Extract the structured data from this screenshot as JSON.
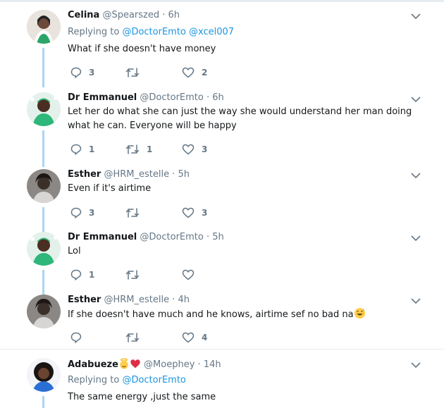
{
  "tweets": [
    {
      "name": "Celina",
      "handle": "@Spearszed",
      "time": "6h",
      "replying_prefix": "Replying to",
      "replying_to": [
        "@DoctorEmto",
        "@xcel007"
      ],
      "text": "What if she doesn't have money",
      "replies": "3",
      "retweets": "",
      "likes": "2"
    },
    {
      "name": "Dr Emmanuel",
      "handle": "@DoctorEmto",
      "time": "6h",
      "text": "Let her do what she can just the way she would understand her man doing what he can. Everyone will be happy",
      "replies": "1",
      "retweets": "1",
      "likes": "3"
    },
    {
      "name": "Esther",
      "handle": "@HRM_estelle",
      "time": "5h",
      "text": "Even if it's airtime",
      "replies": "3",
      "retweets": "",
      "likes": "3"
    },
    {
      "name": "Dr Emmanuel",
      "handle": "@DoctorEmto",
      "time": "5h",
      "text": "Lol",
      "replies": "1",
      "retweets": "",
      "likes": ""
    },
    {
      "name": "Esther",
      "handle": "@HRM_estelle",
      "time": "4h",
      "text": "If she doesn't have much and he knows, airtime sef no bad na",
      "replies": "",
      "retweets": "",
      "likes": "4"
    },
    {
      "name": "Adabueze",
      "handle": "@Moephey",
      "time": "14h",
      "replying_prefix": "Replying to",
      "replying_to": [
        "@DoctorEmto"
      ],
      "text": "The same energy ,just the same"
    }
  ],
  "dot": "·",
  "colors": {
    "link": "#1b95e0",
    "muted": "#657786",
    "thread": "#a9d7f2"
  },
  "icons": [
    "reply-icon",
    "retweet-icon",
    "like-icon",
    "chevron-down-icon",
    "grinning-sweat-emoji",
    "angel-emoji",
    "heart-emoji"
  ]
}
